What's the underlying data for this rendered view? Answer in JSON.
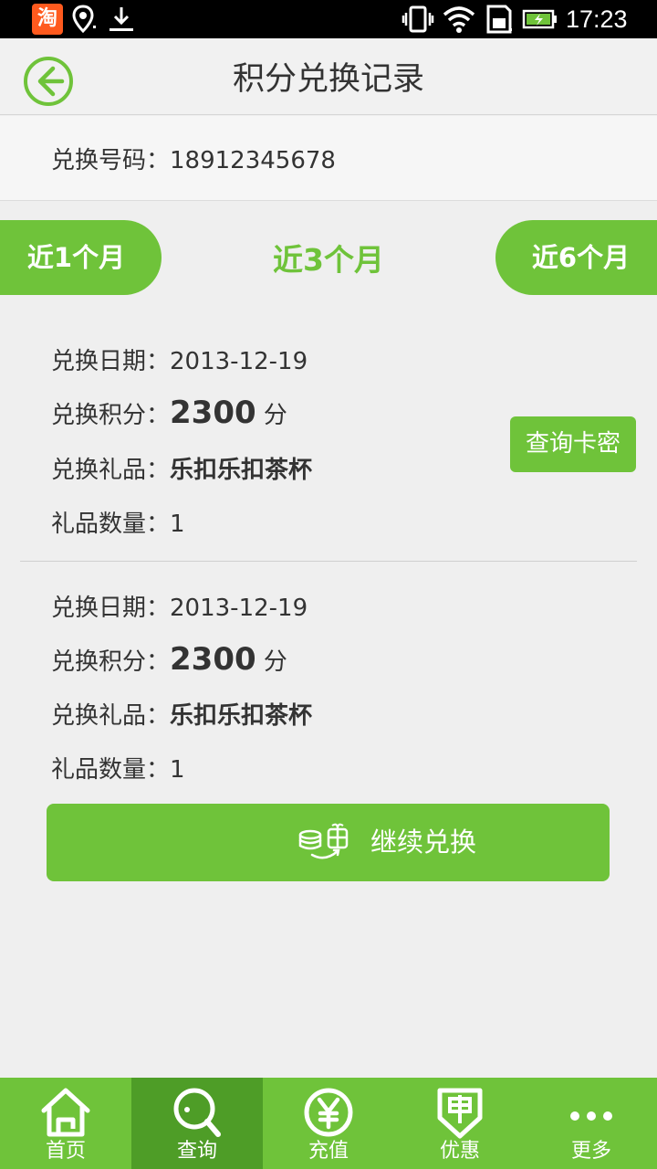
{
  "status_bar": {
    "taobao_glyph": "淘",
    "time": "17:23",
    "icons": [
      "taobao-icon",
      "location-icon",
      "download-icon",
      "vibrate-icon",
      "wifi-icon",
      "sd-card-icon",
      "battery-charging-icon"
    ]
  },
  "header": {
    "title": "积分兑换记录",
    "back_icon": "back-arrow-icon"
  },
  "account": {
    "label": "兑换号码：",
    "number": "18912345678"
  },
  "tabs": [
    {
      "label": "近1个月",
      "active": false
    },
    {
      "label": "近3个月",
      "active": true
    },
    {
      "label": "近6个月",
      "active": false
    }
  ],
  "labels": {
    "date": "兑换日期：",
    "points": "兑换积分：",
    "gift": "兑换礼品：",
    "quantity": "礼品数量：",
    "points_unit": "分"
  },
  "records": [
    {
      "date": "2013-12-19",
      "points": "2300",
      "gift": "乐扣乐扣茶杯",
      "quantity": "1",
      "action": "查询卡密"
    },
    {
      "date": "2013-12-19",
      "points": "2300",
      "gift": "乐扣乐扣茶杯",
      "quantity": "1"
    }
  ],
  "continue_button": {
    "label": "继续兑换",
    "icon": "coins-gift-icon"
  },
  "bottom_nav": [
    {
      "label": "首页",
      "icon": "home-icon",
      "active": false
    },
    {
      "label": "查询",
      "icon": "search-icon",
      "active": true
    },
    {
      "label": "充值",
      "icon": "yuan-icon",
      "active": false
    },
    {
      "label": "优惠",
      "icon": "coupon-icon",
      "active": false
    },
    {
      "label": "更多",
      "icon": "more-icon",
      "active": false
    }
  ],
  "colors": {
    "accent": "#6fc33a",
    "accent_dark": "#4e9d27",
    "background": "#efefef",
    "text": "#333333"
  }
}
